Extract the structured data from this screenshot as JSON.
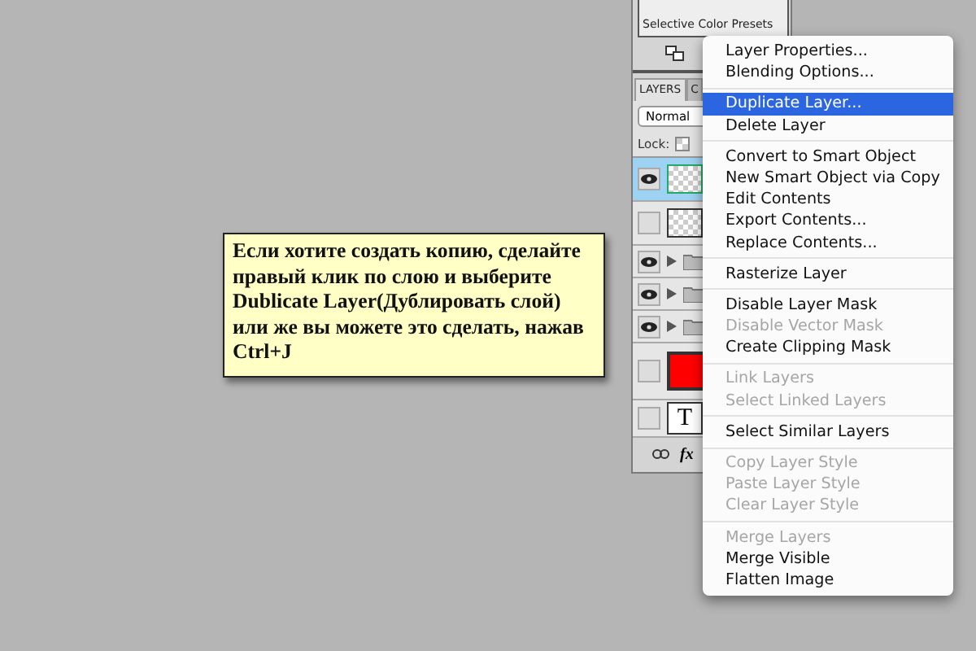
{
  "presets_panel": {
    "items": [
      {
        "label": "Selective Color Presets"
      }
    ]
  },
  "layers_panel": {
    "tabs": [
      {
        "label": "LAYERS",
        "selected": true
      },
      {
        "label": "C",
        "selected": false
      }
    ],
    "blend_mode": "Normal",
    "lock_label": "Lock:",
    "layers": [
      {
        "kind": "smart",
        "visible": true,
        "selected": true
      },
      {
        "kind": "pattern",
        "visible": false,
        "selected": false
      },
      {
        "kind": "folder",
        "visible": true,
        "selected": false
      },
      {
        "kind": "folder",
        "visible": true,
        "selected": false
      },
      {
        "kind": "folder",
        "visible": true,
        "selected": false
      },
      {
        "kind": "fill",
        "visible": false,
        "selected": false,
        "color": "#ff0000"
      },
      {
        "kind": "text",
        "visible": false,
        "selected": false,
        "glyph": "T"
      }
    ],
    "footer_fx": "fx"
  },
  "context_menu": {
    "items": [
      {
        "kind": "item",
        "label": "Layer Properties...",
        "disabled": false,
        "selected": false
      },
      {
        "kind": "item",
        "label": "Blending Options...",
        "disabled": false,
        "selected": false
      },
      {
        "kind": "separator"
      },
      {
        "kind": "item",
        "label": "Duplicate Layer...",
        "disabled": false,
        "selected": true
      },
      {
        "kind": "item",
        "label": "Delete Layer",
        "disabled": false,
        "selected": false
      },
      {
        "kind": "separator"
      },
      {
        "kind": "item",
        "label": "Convert to Smart Object",
        "disabled": false,
        "selected": false
      },
      {
        "kind": "item",
        "label": "New Smart Object via Copy",
        "disabled": false,
        "selected": false
      },
      {
        "kind": "item",
        "label": "Edit Contents",
        "disabled": false,
        "selected": false
      },
      {
        "kind": "item",
        "label": "Export Contents...",
        "disabled": false,
        "selected": false
      },
      {
        "kind": "item",
        "label": "Replace Contents...",
        "disabled": false,
        "selected": false
      },
      {
        "kind": "separator"
      },
      {
        "kind": "item",
        "label": "Rasterize Layer",
        "disabled": false,
        "selected": false
      },
      {
        "kind": "separator"
      },
      {
        "kind": "item",
        "label": "Disable Layer Mask",
        "disabled": false,
        "selected": false
      },
      {
        "kind": "item",
        "label": "Disable Vector Mask",
        "disabled": true,
        "selected": false
      },
      {
        "kind": "item",
        "label": "Create Clipping Mask",
        "disabled": false,
        "selected": false
      },
      {
        "kind": "separator"
      },
      {
        "kind": "item",
        "label": "Link Layers",
        "disabled": true,
        "selected": false
      },
      {
        "kind": "item",
        "label": "Select Linked Layers",
        "disabled": true,
        "selected": false
      },
      {
        "kind": "separator"
      },
      {
        "kind": "item",
        "label": "Select Similar Layers",
        "disabled": false,
        "selected": false
      },
      {
        "kind": "separator"
      },
      {
        "kind": "item",
        "label": "Copy Layer Style",
        "disabled": true,
        "selected": false
      },
      {
        "kind": "item",
        "label": "Paste Layer Style",
        "disabled": true,
        "selected": false
      },
      {
        "kind": "item",
        "label": "Clear Layer Style",
        "disabled": true,
        "selected": false
      },
      {
        "kind": "separator"
      },
      {
        "kind": "item",
        "label": "Merge Layers",
        "disabled": true,
        "selected": false
      },
      {
        "kind": "item",
        "label": "Merge Visible",
        "disabled": false,
        "selected": false
      },
      {
        "kind": "item",
        "label": "Flatten Image",
        "disabled": false,
        "selected": false
      }
    ]
  },
  "callout": {
    "text": "Если хотите создать копию, сделайте правый клик по слою и выберите Dublicate Layer(Дублировать слой) или же вы можете это сделать, нажав Ctrl+J"
  }
}
